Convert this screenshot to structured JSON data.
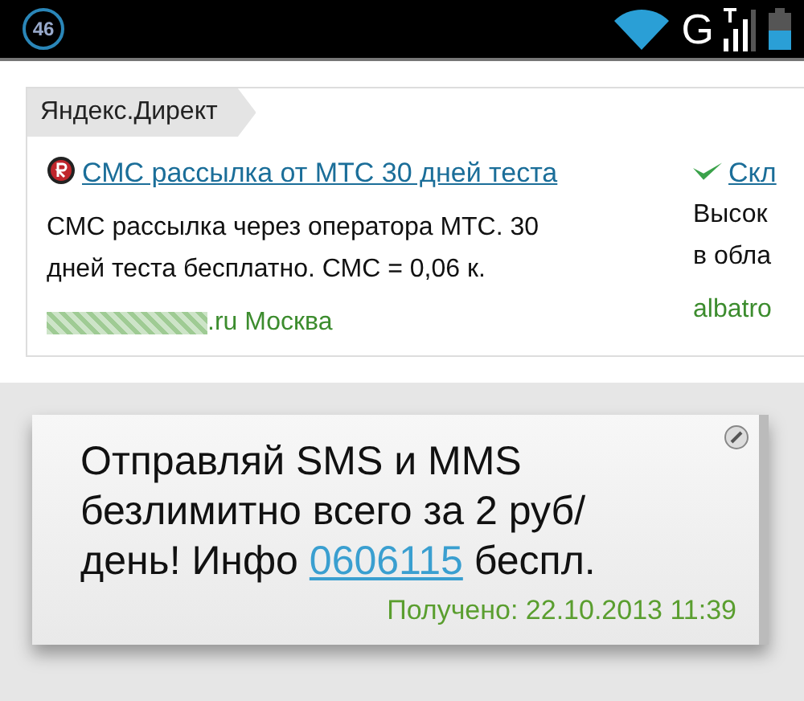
{
  "status_bar": {
    "notification_count": "46",
    "network_type": "G"
  },
  "ad_block": {
    "label": "Яндекс.Директ",
    "ads": [
      {
        "title": "СМС рассылка от МТС 30 дней теста",
        "text": "СМС рассылка через оператора МТС. 30 дней теста бесплатно. СМС = 0,06 к.",
        "domain": ".ru",
        "region": "Москва",
        "kind": "round"
      },
      {
        "title": "Скл",
        "text_lines": [
          "Высок",
          "в обла"
        ],
        "domain": "albatro",
        "kind": "check"
      }
    ]
  },
  "message": {
    "text_before": "Отправляй SMS и MMS безлимитно всего за 2 руб/ день! Инфо ",
    "link": "0606115",
    "text_after": " беспл.",
    "received": "Получено: 22.10.2013 11:39"
  }
}
